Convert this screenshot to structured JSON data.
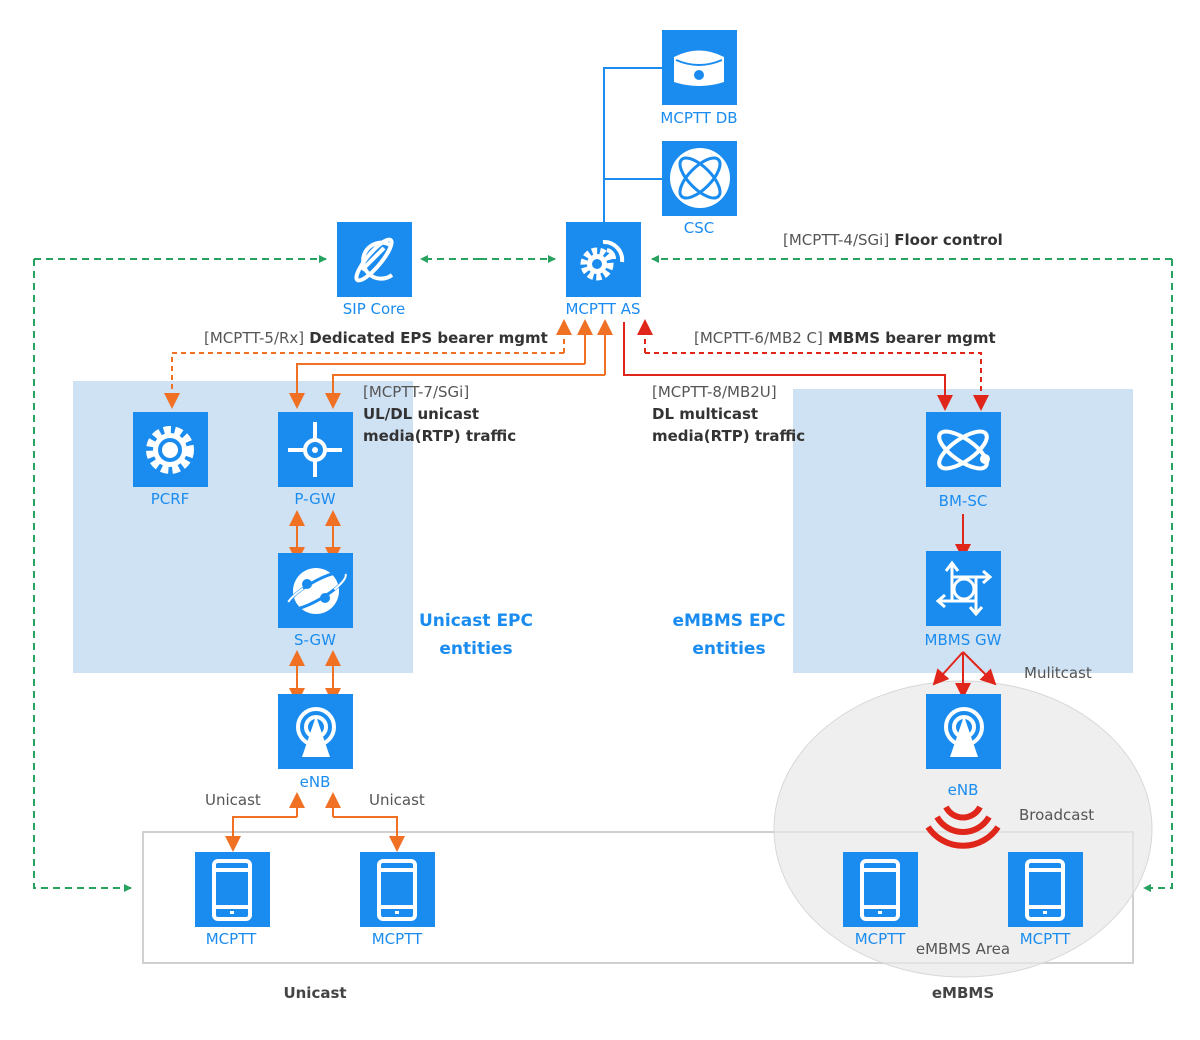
{
  "colors": {
    "node": "#1a8cf0",
    "sip_signaling": "#27a35f",
    "unicast": "#f07124",
    "multicast": "#e0261b",
    "epc_region": "#cfe2f3",
    "db_link": "#1a8cf0"
  },
  "nodes": {
    "mcptt_db": {
      "label": "MCPTT DB",
      "icon": "database-icon"
    },
    "csc": {
      "label": "CSC",
      "icon": "atom-icon"
    },
    "sip_core": {
      "label": "SIP Core",
      "icon": "planet-icon"
    },
    "mcptt_as": {
      "label": "MCPTT AS",
      "icon": "gear-signal-icon"
    },
    "pcrf": {
      "label": "PCRF",
      "icon": "gear-icon"
    },
    "pgw": {
      "label": "P-GW",
      "icon": "crosshair-icon"
    },
    "sgw": {
      "label": "S-GW",
      "icon": "globe-orbit-icon"
    },
    "enb_unicast": {
      "label": "eNB",
      "icon": "antenna-icon"
    },
    "bmsc": {
      "label": "BM-SC",
      "icon": "atom-icon"
    },
    "mbms_gw": {
      "label": "MBMS GW",
      "icon": "router-arrows-icon"
    },
    "enb_embms": {
      "label": "eNB",
      "icon": "antenna-icon"
    },
    "ue1": {
      "label": "MCPTT",
      "icon": "phone-icon"
    },
    "ue2": {
      "label": "MCPTT",
      "icon": "phone-icon"
    },
    "ue3": {
      "label": "MCPTT",
      "icon": "phone-icon"
    },
    "ue4": {
      "label": "MCPTT",
      "icon": "phone-icon"
    }
  },
  "interfaces": {
    "mcptt4": {
      "ref": "[MCPTT-4/SGi]",
      "desc": "Floor control"
    },
    "mcptt5": {
      "ref": "[MCPTT-5/Rx]",
      "desc": "Dedicated EPS bearer mgmt"
    },
    "mcptt6": {
      "ref": "[MCPTT-6/MB2 C]",
      "desc": "MBMS bearer mgmt"
    },
    "mcptt7": {
      "ref": "[MCPTT-7/SGi]",
      "desc1": "UL/DL unicast",
      "desc2": "media(RTP) traffic"
    },
    "mcptt8": {
      "ref": "[MCPTT-8/MB2U]",
      "desc1": "DL multicast",
      "desc2": "media(RTP) traffic"
    }
  },
  "regions": {
    "unicast_epc": [
      "Unicast EPC",
      "entities"
    ],
    "embms_epc": [
      "eMBMS EPC",
      "entities"
    ],
    "embms_area": "eMBMS Area"
  },
  "annotations": {
    "unicast_left": "Unicast",
    "unicast_right": "Unicast",
    "multicast": "Mulitcast",
    "broadcast": "Broadcast",
    "bottom_unicast": "Unicast",
    "bottom_embms": "eMBMS"
  }
}
